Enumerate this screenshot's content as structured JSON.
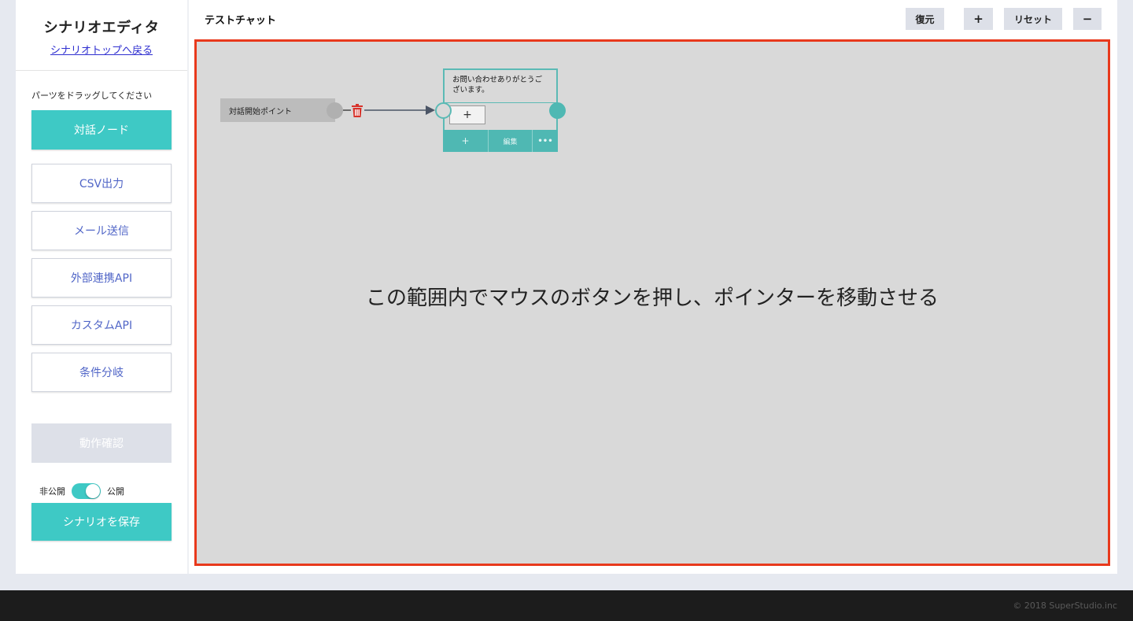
{
  "sidebar": {
    "title": "シナリオエディタ",
    "back_link": "シナリオトップへ戻る",
    "hint": "パーツをドラッグしてください",
    "parts": {
      "dialog_node": "対話ノード",
      "csv_export": "CSV出力",
      "mail_send": "メール送信",
      "external_api": "外部連携API",
      "custom_api": "カスタムAPI",
      "condition_branch": "条件分岐"
    },
    "test_button": "動作確認",
    "visibility": {
      "private_label": "非公開",
      "public_label": "公開",
      "is_public": true
    },
    "save_button": "シナリオを保存"
  },
  "main": {
    "title": "テストチャット",
    "toolbar": {
      "restore": "復元",
      "zoom_in": "+",
      "reset": "リセット",
      "zoom_out": "−"
    },
    "canvas": {
      "instruction": "この範囲内でマウスのボタンを押し、ポインターを移動させる",
      "start_node": {
        "label": "対話開始ポイント"
      },
      "dialog_node": {
        "text": "お問い合わせありがとうございます。",
        "add_button": "+",
        "footer": {
          "add": "+",
          "edit": "編集",
          "more": "•••"
        }
      }
    }
  },
  "colors": {
    "accent": "#3ec9c5",
    "node_border": "#5bbab5",
    "canvas_border": "#e8391c",
    "link_text": "#2f2fd0",
    "outline_text": "#5166c7",
    "delete": "#d8322a"
  },
  "footer": {
    "copyright": "© 2018 SuperStudio.inc"
  }
}
